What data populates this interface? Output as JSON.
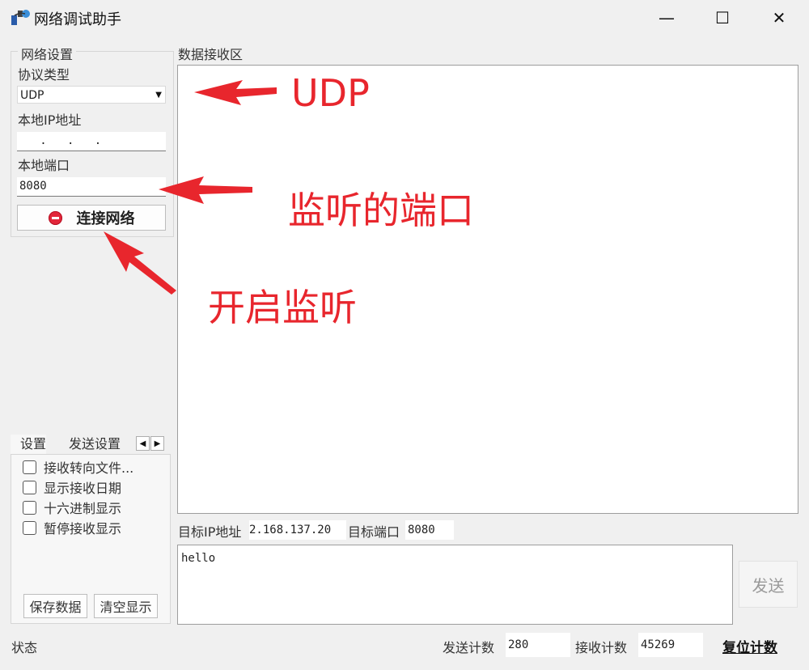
{
  "window": {
    "title": "网络调试助手",
    "controls": {
      "minimize": "—",
      "maximize": "☐",
      "close": "✕"
    }
  },
  "network_settings": {
    "legend": "网络设置",
    "protocol_label": "协议类型",
    "protocol_value": "UDP",
    "local_ip_label": "本地IP地址",
    "local_ip_value": "   .   .   .",
    "local_port_label": "本地端口",
    "local_port_value": "8080",
    "connect_button": "连接网络"
  },
  "receive_area": {
    "label": "数据接收区",
    "content": ""
  },
  "settings_tabs": {
    "tabs": [
      "设置",
      "发送设置"
    ],
    "active_tab": "设置",
    "scroll_left": "◀",
    "scroll_right": "▶",
    "checkboxes": [
      {
        "label": "接收转向文件...",
        "checked": false
      },
      {
        "label": "显示接收日期",
        "checked": false
      },
      {
        "label": "十六进制显示",
        "checked": false
      },
      {
        "label": "暂停接收显示",
        "checked": false
      }
    ],
    "save_button": "保存数据",
    "clear_button": "清空显示"
  },
  "send_section": {
    "target_ip_label": "目标IP地址",
    "target_ip_value": "2.168.137.20",
    "target_port_label": "目标端口",
    "target_port_value": "8080",
    "message": "hello",
    "send_button": "发送"
  },
  "status_bar": {
    "status_label": "状态",
    "send_count_label": "发送计数",
    "send_count_value": "280",
    "recv_count_label": "接收计数",
    "recv_count_value": "45269",
    "reset_button": "复位计数"
  },
  "annotations": {
    "udp": "UDP",
    "listen_port": "监听的端口",
    "start_listen": "开启监听",
    "color": "#e8262d"
  },
  "icons": [
    "app-icon",
    "minimize-icon",
    "maximize-icon",
    "close-icon",
    "dropdown-arrow-icon",
    "stop-icon"
  ]
}
